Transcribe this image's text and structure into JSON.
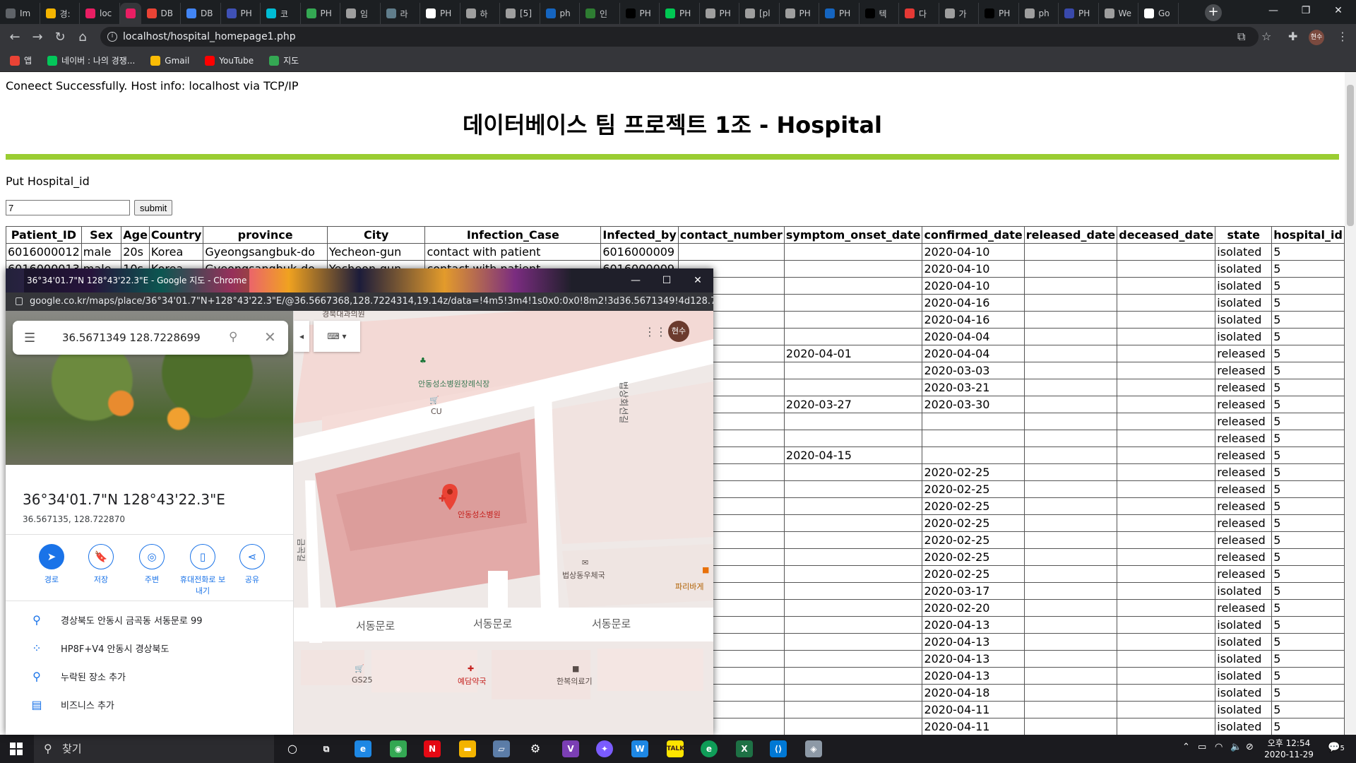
{
  "browser": {
    "tabs": [
      {
        "label": "Im",
        "color": "#5f6368"
      },
      {
        "label": "경:",
        "color": "#f4b400"
      },
      {
        "label": "loc",
        "color": "#e91e63"
      },
      {
        "label": "",
        "color": "#e91e63",
        "active": true
      },
      {
        "label": "DB",
        "color": "#ea4335"
      },
      {
        "label": "DB",
        "color": "#4285f4"
      },
      {
        "label": "PH",
        "color": "#3f51b5"
      },
      {
        "label": "코",
        "color": "#00bcd4"
      },
      {
        "label": "PH",
        "color": "#34a853"
      },
      {
        "label": "임",
        "color": "#9e9e9e"
      },
      {
        "label": "라",
        "color": "#607d8b"
      },
      {
        "label": "PH",
        "color": "#ffffff"
      },
      {
        "label": "하",
        "color": "#9e9e9e"
      },
      {
        "label": "[5]",
        "color": "#9e9e9e"
      },
      {
        "label": "ph",
        "color": "#1565c0"
      },
      {
        "label": "인",
        "color": "#2e7d32"
      },
      {
        "label": "PH",
        "color": "#000000"
      },
      {
        "label": "PH",
        "color": "#00c853"
      },
      {
        "label": "PH",
        "color": "#9e9e9e"
      },
      {
        "label": "[pl",
        "color": "#9e9e9e"
      },
      {
        "label": "PH",
        "color": "#9e9e9e"
      },
      {
        "label": "PH",
        "color": "#1565c0"
      },
      {
        "label": "텍",
        "color": "#000000"
      },
      {
        "label": "다",
        "color": "#e53935"
      },
      {
        "label": "가",
        "color": "#9e9e9e"
      },
      {
        "label": "PH",
        "color": "#000000"
      },
      {
        "label": "ph",
        "color": "#9e9e9e"
      },
      {
        "label": "PH",
        "color": "#3949ab"
      },
      {
        "label": "We",
        "color": "#9e9e9e"
      },
      {
        "label": "Go",
        "color": "#ffffff"
      }
    ],
    "url": "localhost/hospital_homepage1.php",
    "profile": "현수",
    "bookmarks": [
      {
        "label": "앱",
        "color": "#ea4335"
      },
      {
        "label": "네이버 : 나의 경쟁...",
        "color": "#03c75a"
      },
      {
        "label": "Gmail",
        "color": "#fbbc05"
      },
      {
        "label": "YouTube",
        "color": "#ff0000"
      },
      {
        "label": "지도",
        "color": "#34a853"
      }
    ]
  },
  "page": {
    "connection": "Coneect Successfully. Host info: localhost via TCP/IP",
    "title": "데이터베이스 팀 프로젝트 1조 - Hospital",
    "put_label": "Put Hospital_id",
    "input_value": "7",
    "submit_label": "submit",
    "accent_color": "#9acd32"
  },
  "table": {
    "headers": [
      "Patient_ID",
      "Sex",
      "Age",
      "Country",
      "province",
      "City",
      "Infection_Case",
      "Infected_by",
      "contact_number",
      "symptom_onset_date",
      "confirmed_date",
      "released_date",
      "deceased_date",
      "state",
      "hospital_id"
    ],
    "rows": [
      [
        "6016000012",
        "male",
        "20s",
        "Korea",
        "Gyeongsangbuk-do",
        "Yecheon-gun",
        "contact with patient",
        "6016000009",
        "",
        "",
        "2020-04-10",
        "",
        "",
        "isolated",
        "5"
      ],
      [
        "6016000013",
        "male",
        "10s",
        "Korea",
        "Gyeongsangbuk-do",
        "Yecheon-gun",
        "contact with patient",
        "6016000009",
        "",
        "",
        "2020-04-10",
        "",
        "",
        "isolated",
        "5"
      ],
      [
        "",
        "",
        "",
        "",
        "",
        "",
        "",
        "",
        "",
        "",
        "2020-04-10",
        "",
        "",
        "isolated",
        "5"
      ],
      [
        "",
        "",
        "",
        "",
        "",
        "",
        "",
        "",
        "",
        "",
        "2020-04-16",
        "",
        "",
        "isolated",
        "5"
      ],
      [
        "",
        "",
        "",
        "",
        "",
        "",
        "",
        "",
        "",
        "",
        "2020-04-16",
        "",
        "",
        "isolated",
        "5"
      ],
      [
        "",
        "",
        "",
        "",
        "",
        "",
        "",
        "",
        "",
        "",
        "2020-04-04",
        "",
        "",
        "isolated",
        "5"
      ],
      [
        "",
        "",
        "",
        "",
        "",
        "",
        "",
        "",
        "",
        "2020-04-01",
        "2020-04-04",
        "",
        "",
        "released",
        "5"
      ],
      [
        "",
        "",
        "",
        "",
        "",
        "",
        "",
        "",
        "",
        "",
        "2020-03-03",
        "",
        "",
        "released",
        "5"
      ],
      [
        "",
        "",
        "",
        "",
        "",
        "",
        "",
        "",
        "",
        "",
        "2020-03-21",
        "",
        "",
        "released",
        "5"
      ],
      [
        "",
        "",
        "",
        "",
        "",
        "",
        "",
        "",
        "",
        "2020-03-27",
        "2020-03-30",
        "",
        "",
        "released",
        "5"
      ],
      [
        "",
        "",
        "",
        "",
        "",
        "",
        "",
        "",
        "",
        "",
        "",
        "",
        "",
        "released",
        "5"
      ],
      [
        "",
        "",
        "",
        "",
        "",
        "",
        "",
        "",
        "",
        "",
        "",
        "",
        "",
        "released",
        "5"
      ],
      [
        "",
        "",
        "",
        "",
        "",
        "",
        "",
        "",
        "",
        "2020-04-15",
        "",
        "",
        "",
        "released",
        "5"
      ],
      [
        "",
        "",
        "",
        "",
        "",
        "",
        "",
        "",
        "",
        "",
        "2020-02-25",
        "",
        "",
        "released",
        "5"
      ],
      [
        "",
        "",
        "",
        "",
        "",
        "",
        "",
        "",
        "",
        "",
        "2020-02-25",
        "",
        "",
        "released",
        "5"
      ],
      [
        "",
        "",
        "",
        "",
        "",
        "",
        "",
        "",
        "",
        "",
        "2020-02-25",
        "",
        "",
        "released",
        "5"
      ],
      [
        "",
        "",
        "",
        "",
        "",
        "",
        "",
        "",
        "",
        "",
        "2020-02-25",
        "",
        "",
        "released",
        "5"
      ],
      [
        "",
        "",
        "",
        "",
        "",
        "",
        "",
        "",
        "",
        "",
        "2020-02-25",
        "",
        "",
        "released",
        "5"
      ],
      [
        "",
        "",
        "",
        "",
        "",
        "",
        "",
        "",
        "",
        "",
        "2020-02-25",
        "",
        "",
        "released",
        "5"
      ],
      [
        "",
        "",
        "",
        "",
        "",
        "",
        "",
        "",
        "",
        "",
        "2020-02-25",
        "",
        "",
        "released",
        "5"
      ],
      [
        "",
        "",
        "",
        "",
        "",
        "",
        "",
        "",
        "",
        "",
        "2020-03-17",
        "",
        "",
        "isolated",
        "5"
      ],
      [
        "",
        "",
        "",
        "",
        "",
        "",
        "",
        "",
        "",
        "",
        "2020-02-20",
        "",
        "",
        "released",
        "5"
      ],
      [
        "",
        "",
        "",
        "",
        "",
        "",
        "",
        "",
        "",
        "",
        "2020-04-13",
        "",
        "",
        "isolated",
        "5"
      ],
      [
        "",
        "",
        "",
        "",
        "",
        "",
        "",
        "",
        "",
        "",
        "2020-04-13",
        "",
        "",
        "isolated",
        "5"
      ],
      [
        "",
        "",
        "",
        "",
        "",
        "",
        "",
        "",
        "",
        "",
        "2020-04-13",
        "",
        "",
        "isolated",
        "5"
      ],
      [
        "",
        "",
        "",
        "",
        "",
        "",
        "",
        "",
        "",
        "",
        "2020-04-13",
        "",
        "",
        "isolated",
        "5"
      ],
      [
        "",
        "",
        "",
        "",
        "",
        "",
        "",
        "",
        "",
        "",
        "2020-04-18",
        "",
        "",
        "isolated",
        "5"
      ],
      [
        "",
        "",
        "",
        "",
        "",
        "",
        "",
        "",
        "",
        "",
        "2020-04-11",
        "",
        "",
        "isolated",
        "5"
      ],
      [
        "",
        "",
        "",
        "",
        "",
        "",
        "",
        "",
        "",
        "",
        "2020-04-11",
        "",
        "",
        "isolated",
        "5"
      ]
    ]
  },
  "popup": {
    "title": "36°34'01.7\"N 128°43'22.3\"E - Google 지도 - Chrome",
    "url": "google.co.kr/maps/place/36°34'01.7\"N+128°43'22.3\"E/@36.5667368,128.7224314,19.14z/data=!4m5!3m4!1s0x0:0x0!8m2!3d36.5671349!4d128.7...",
    "search_query": "36.5671349 128.7228699",
    "coord_title": "36°34'01.7\"N 128°43'22.3\"E",
    "coord_decimal": "36.567135, 128.722870",
    "actions": [
      {
        "label": "경로",
        "icon": "directions-icon",
        "glyph": "➤",
        "filled": true
      },
      {
        "label": "저장",
        "icon": "bookmark-icon",
        "glyph": "🔖",
        "filled": false
      },
      {
        "label": "주변",
        "icon": "nearby-icon",
        "glyph": "◎",
        "filled": false
      },
      {
        "label": "휴대전화로 보내기",
        "icon": "send-to-phone-icon",
        "glyph": "▯",
        "filled": false
      },
      {
        "label": "공유",
        "icon": "share-icon",
        "glyph": "⋖",
        "filled": false
      }
    ],
    "info": [
      {
        "text": "경상북도 안동시 금곡동 서동문로 99",
        "icon": "location-pin-icon",
        "glyph": "⚲"
      },
      {
        "text": "HP8F+V4 안동시 경상북도",
        "icon": "plus-code-icon",
        "glyph": "⁘"
      },
      {
        "text": "누락된 장소 추가",
        "icon": "add-place-icon",
        "glyph": "⚲"
      },
      {
        "text": "비즈니스 추가",
        "icon": "add-business-icon",
        "glyph": "▤"
      }
    ],
    "map_labels": {
      "funeral": "안동성소병원장례식장",
      "cu": "CU",
      "hospital": "안동성소병원",
      "post": "법상동우체국",
      "paris": "파리바게",
      "gs25": "GS25",
      "pharmacy": "예담약국",
      "hanbok": "한복의료기",
      "road1": "서동문로",
      "road2": "서동문로",
      "road3": "서동문로",
      "road_vert": "법상회선길",
      "road_left": "금곡길",
      "top_clip": "경북대과의원"
    },
    "avatar": "현수"
  },
  "taskbar": {
    "search_placeholder": "찾기",
    "clock_time": "오후 12:54",
    "clock_date": "2020-11-29",
    "notif_count": "5"
  }
}
